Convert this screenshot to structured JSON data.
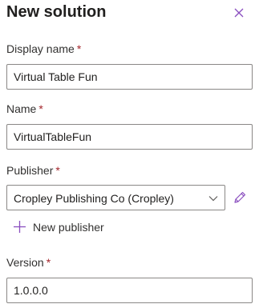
{
  "panel": {
    "title": "New solution",
    "close_icon": "close-icon"
  },
  "fields": {
    "display_name": {
      "label": "Display name",
      "required_marker": "*",
      "value": "Virtual Table Fun"
    },
    "name": {
      "label": "Name",
      "required_marker": "*",
      "value": "VirtualTableFun"
    },
    "publisher": {
      "label": "Publisher",
      "required_marker": "*",
      "selected": "Cropley Publishing Co (Cropley)",
      "chevron_icon": "chevron-down-icon",
      "edit_icon": "pencil-icon",
      "new_publisher_label": "New publisher",
      "new_publisher_icon": "plus-icon"
    },
    "version": {
      "label": "Version",
      "required_marker": "*",
      "value": "1.0.0.0"
    }
  },
  "colors": {
    "accent": "#8a4fbf",
    "required": "#a4262c",
    "border": "#8a8886"
  }
}
